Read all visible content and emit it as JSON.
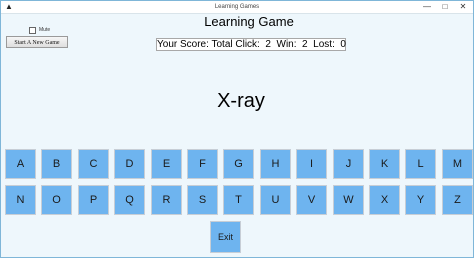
{
  "window": {
    "title": "Learning Games",
    "icon": "triangle-app-icon",
    "controls": {
      "minimize": "—",
      "maximize": "□",
      "close": "✕"
    }
  },
  "options": {
    "mute_label": "Mute",
    "mute_checked": false,
    "new_game_label": "Start A New Game"
  },
  "game": {
    "title": "Learning Game",
    "score_text": "Your Score: Total Click:  2  Win:  2  Lost:  0",
    "word": "X-ray"
  },
  "keyboard": {
    "row1": [
      "A",
      "B",
      "C",
      "D",
      "E",
      "F",
      "G",
      "H",
      "I",
      "J",
      "K",
      "L",
      "M"
    ],
    "row2": [
      "N",
      "O",
      "P",
      "Q",
      "R",
      "S",
      "T",
      "U",
      "V",
      "W",
      "X",
      "Y",
      "Z"
    ]
  },
  "exit_label": "Exit",
  "colors": {
    "background": "#eef7fc",
    "key_fill": "#6eb4ef",
    "key_border": "#c7ced6"
  }
}
